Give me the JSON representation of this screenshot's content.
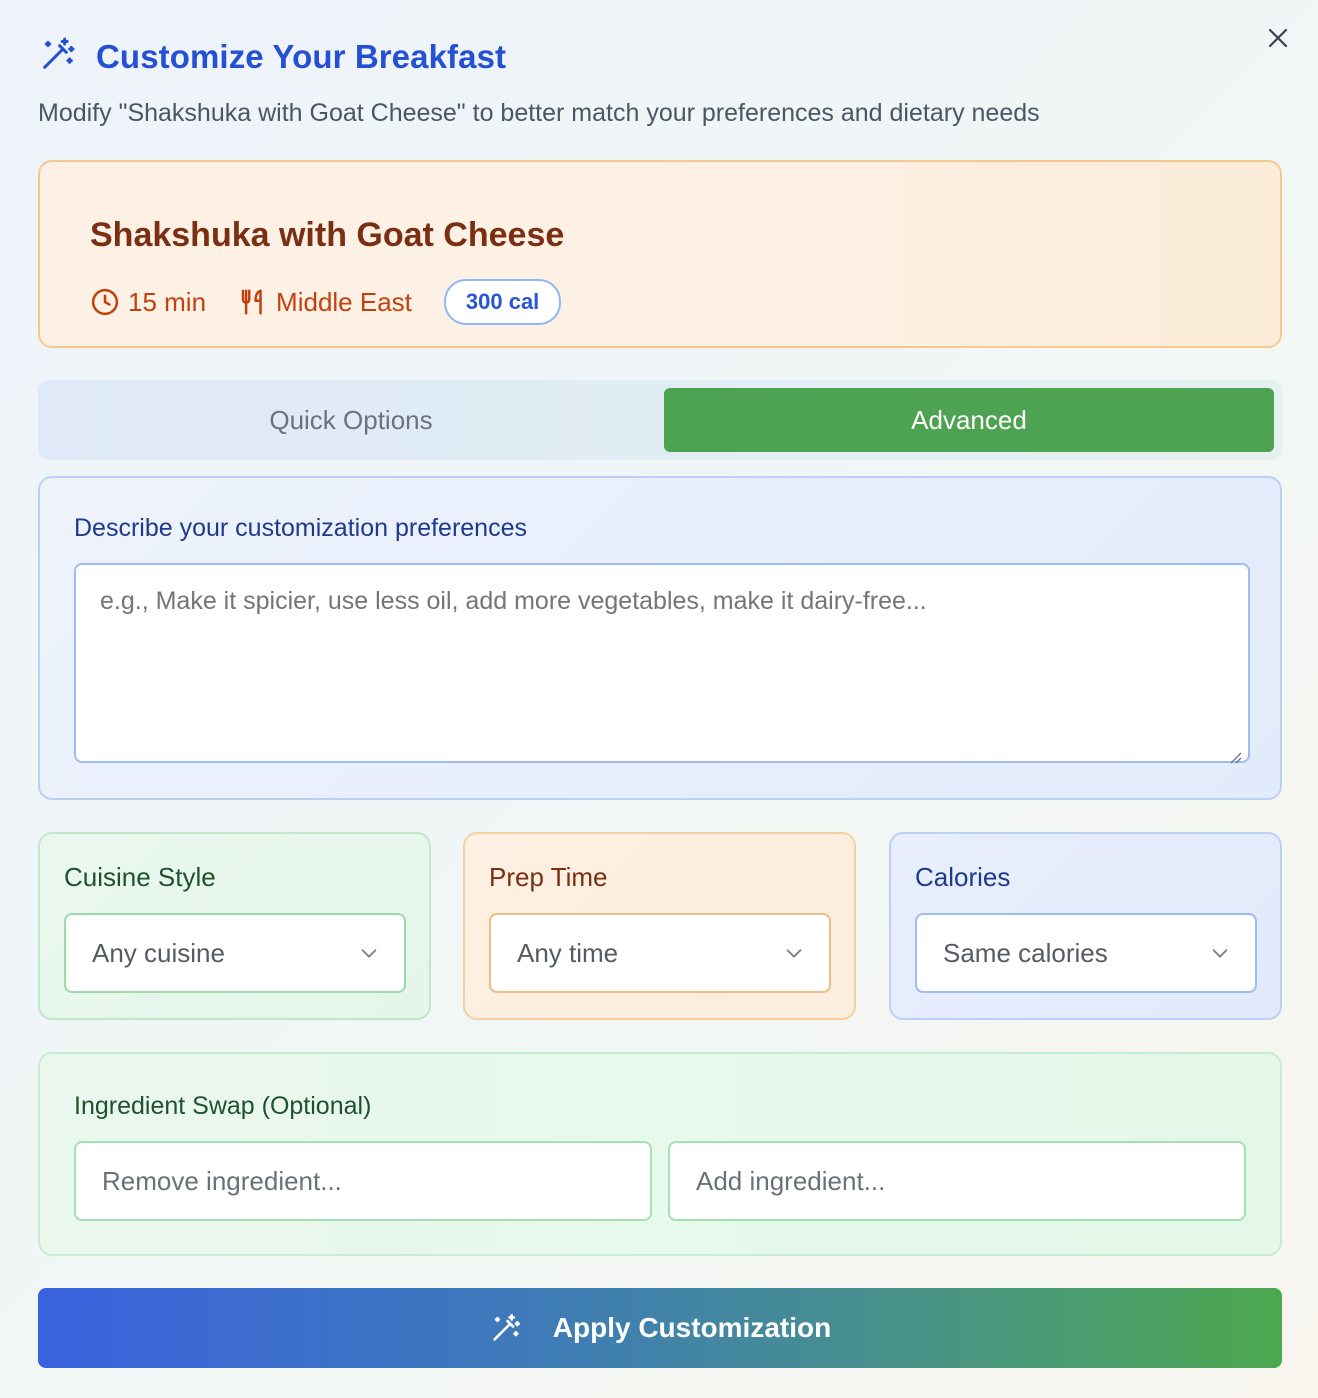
{
  "header": {
    "title": "Customize Your Breakfast",
    "subtitle": "Modify \"Shakshuka with Goat Cheese\" to better match your preferences and dietary needs",
    "title_icon": "magic-wand-icon",
    "close_icon": "close-icon"
  },
  "dish": {
    "name": "Shakshuka with Goat Cheese",
    "time": "15 min",
    "cuisine": "Middle East",
    "calories": "300 cal",
    "time_icon": "clock-icon",
    "cuisine_icon": "utensils-icon"
  },
  "tabs": [
    {
      "label": "Quick Options",
      "active": false
    },
    {
      "label": "Advanced",
      "active": true
    }
  ],
  "describe": {
    "label": "Describe your customization preferences",
    "placeholder": "e.g., Make it spicier, use less oil, add more vegetables, make it dairy-free...",
    "value": ""
  },
  "options": {
    "cuisine": {
      "label": "Cuisine Style",
      "selected": "Any cuisine"
    },
    "prep_time": {
      "label": "Prep Time",
      "selected": "Any time"
    },
    "calories": {
      "label": "Calories",
      "selected": "Same calories"
    }
  },
  "swap": {
    "label": "Ingredient Swap (Optional)",
    "remove_placeholder": "Remove ingredient...",
    "add_placeholder": "Add ingredient..."
  },
  "apply": {
    "label": "Apply Customization",
    "icon": "magic-wand-icon"
  },
  "colors": {
    "primary": "#2450d4",
    "active_tab": "#4ea353",
    "dish_text": "#7a2e12",
    "meta_text": "#c2410c"
  }
}
